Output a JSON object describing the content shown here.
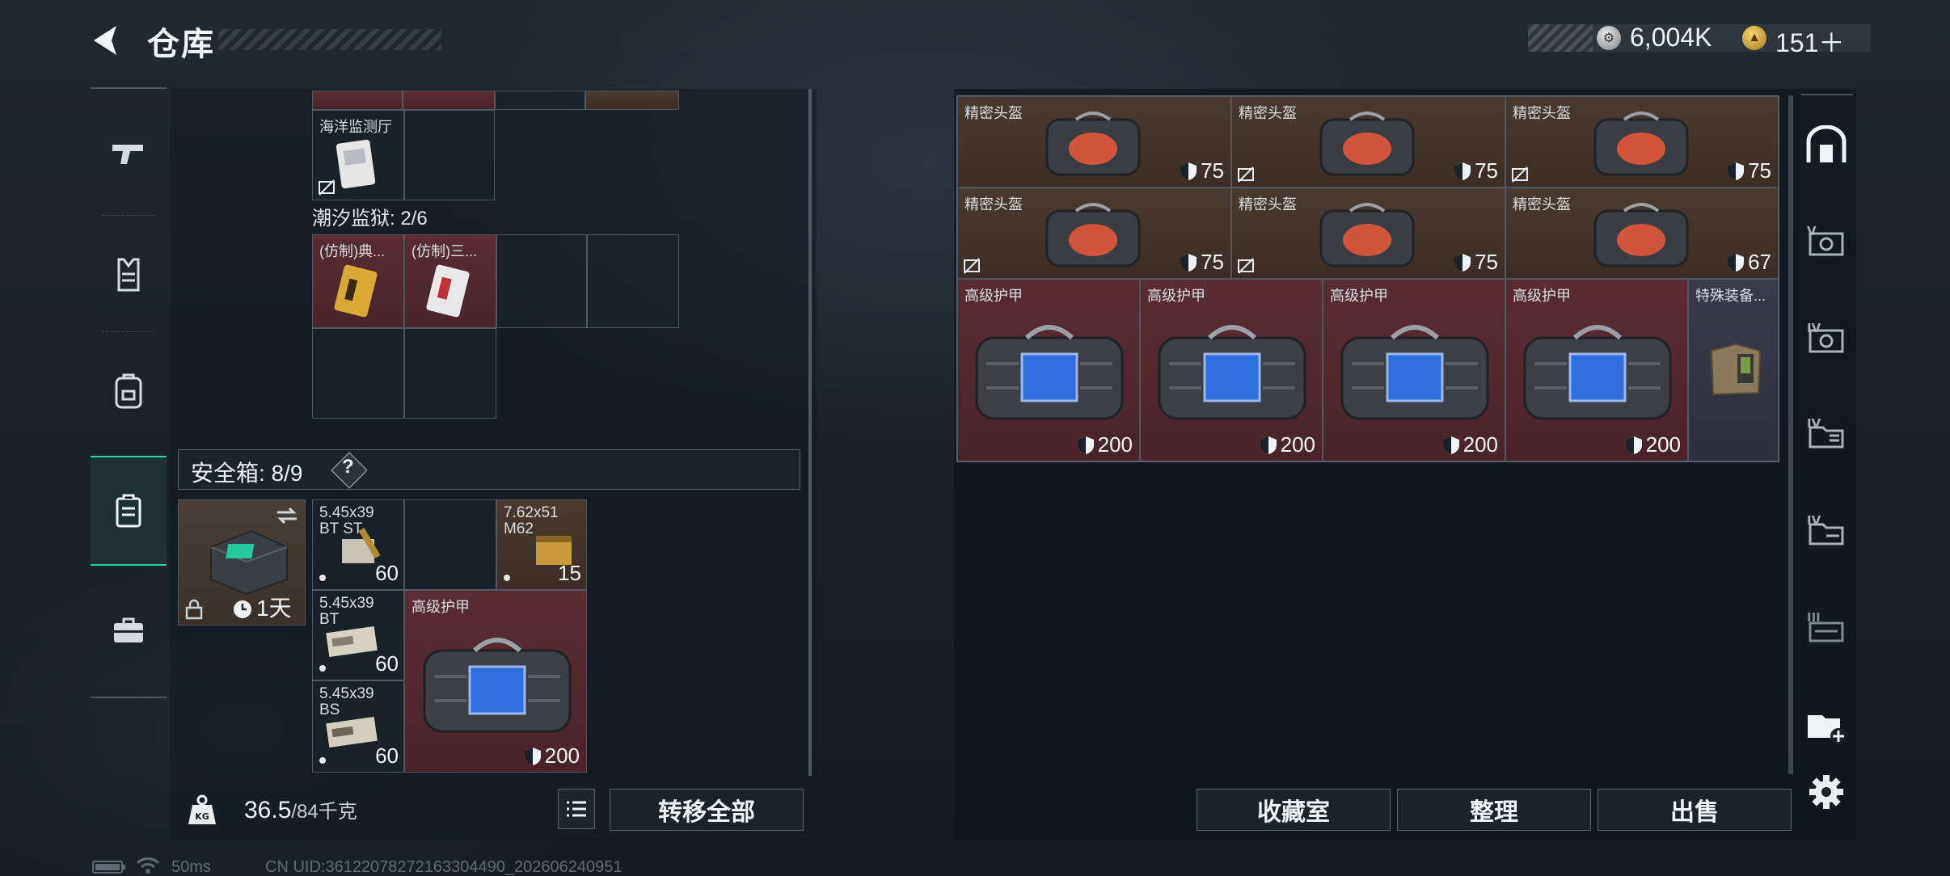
{
  "header": {
    "title": "仓库",
    "currency1": "6,004K",
    "currency2": "151＋"
  },
  "sidebar_left": {
    "items": [
      "weapon-icon",
      "vest-icon",
      "backpack-icon",
      "safe-box-icon",
      "briefcase-icon"
    ],
    "active_index": 3
  },
  "left_panel": {
    "top_item": {
      "label": "海洋监测厅"
    },
    "section": "潮汐监狱: 2/6",
    "section_items": [
      {
        "label": "(仿制)典..."
      },
      {
        "label": "(仿制)三..."
      }
    ],
    "safe_box": {
      "label": "安全箱: 8/9",
      "help": "?",
      "timer": "1天"
    },
    "ammo": [
      {
        "name": "5.45x39\nBT ST",
        "count": "60"
      },
      {
        "name": "7.62x51\nM62",
        "count": "15"
      },
      {
        "name": "5.45x39\nBT",
        "count": "60"
      },
      {
        "name": "5.45x39\nBS",
        "count": "60"
      }
    ],
    "armor": {
      "name": "高级护甲",
      "value": "200"
    },
    "weight": {
      "current": "36.5",
      "max": "/84千克"
    },
    "transfer_all": "转移全部"
  },
  "right_panel": {
    "helmets": [
      {
        "name": "精密头盔",
        "value": "75"
      },
      {
        "name": "精密头盔",
        "value": "75"
      },
      {
        "name": "精密头盔",
        "value": "75"
      },
      {
        "name": "精密头盔",
        "value": "75"
      },
      {
        "name": "精密头盔",
        "value": "75"
      },
      {
        "name": "精密头盔",
        "value": "67"
      }
    ],
    "armors": [
      {
        "name": "高级护甲",
        "value": "200"
      },
      {
        "name": "高级护甲",
        "value": "200"
      },
      {
        "name": "高级护甲",
        "value": "200"
      },
      {
        "name": "高级护甲",
        "value": "200"
      }
    ],
    "special": {
      "name": "特殊装备..."
    },
    "buttons": {
      "collection": "收藏室",
      "sort": "整理",
      "sell": "出售"
    }
  },
  "sidebar_right": {
    "items": [
      "vault-icon",
      "stash-v-icon",
      "stash-iv-a-icon",
      "stash-iv-b-icon",
      "stash-iv-c-icon",
      "stash-iii-icon",
      "add-stash-icon",
      "settings-icon"
    ]
  },
  "status_bar": {
    "ping": "50ms",
    "uid": "CN UID:36122078272163304490_202606240951"
  },
  "colors": {
    "accent": "#2fd3a0",
    "helmet_cell": "#4a3a30",
    "armor_cell": "#5a2c33"
  }
}
